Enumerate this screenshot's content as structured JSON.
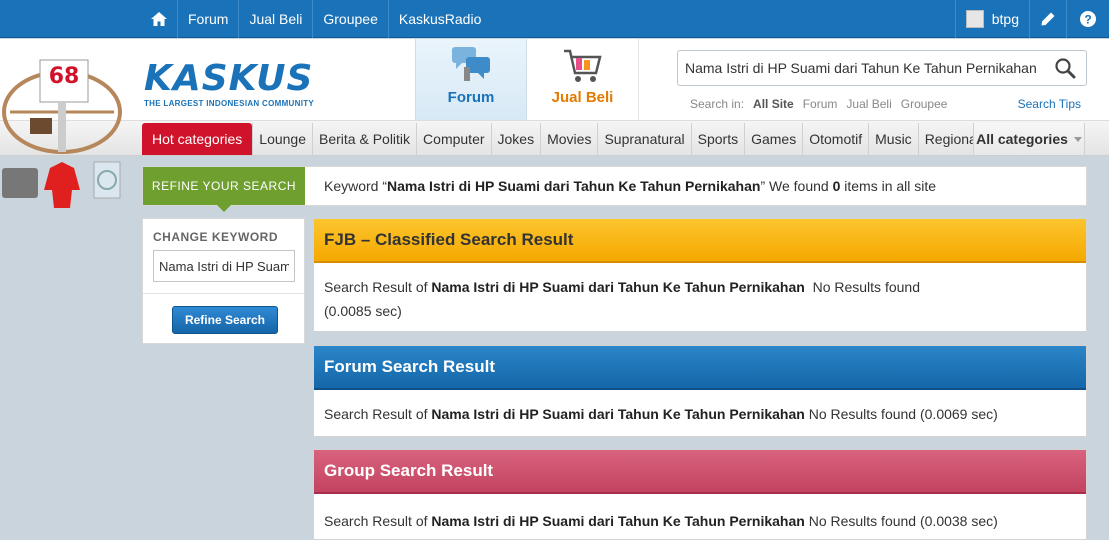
{
  "topnav": {
    "items": [
      "Forum",
      "Jual Beli",
      "Groupee",
      "KaskusRadio"
    ],
    "username": "btpg"
  },
  "header": {
    "logo_text_a": "KASKUS",
    "logo_tagline": "THE LARGEST INDONESIAN COMMUNITY",
    "tab_forum": "Forum",
    "tab_jualbeli": "Jual Beli",
    "search_value": "Nama Istri di HP Suami dari Tahun Ke Tahun Pernikahan",
    "search_in_label": "Search in:",
    "search_in_options": [
      "All Site",
      "Forum",
      "Jual Beli",
      "Groupee"
    ],
    "search_tips": "Search Tips"
  },
  "mascot_badge": "68",
  "categories": {
    "items": [
      "Hot categories",
      "Lounge",
      "Berita & Politik",
      "Computer",
      "Jokes",
      "Movies",
      "Supranatural",
      "Sports",
      "Games",
      "Otomotif",
      "Music",
      "Regional"
    ],
    "all": "All categories"
  },
  "refine": {
    "tag": "REFINE YOUR SEARCH",
    "kw_prefix": "Keyword “",
    "kw_value": "Nama Istri di HP Suami dari Tahun Ke Tahun Pernikahan",
    "kw_mid": "” We found ",
    "kw_count": "0",
    "kw_suffix": " items in all site"
  },
  "change_keyword": {
    "title": "CHANGE KEYWORD",
    "value": "Nama Istri di HP Suami dari Tahun Ke Tahun Pernikahan",
    "button": "Refine Search"
  },
  "results": {
    "fjb": {
      "title": "FJB – Classified Search Result",
      "prefix": "Search Result of ",
      "term": "Nama Istri di HP Suami dari Tahun Ke Tahun Pernikahan",
      "suffix": "  No Results found (0.0085 sec)"
    },
    "forum": {
      "title": "Forum Search Result",
      "prefix": "Search Result of ",
      "term": "Nama Istri di HP Suami dari Tahun Ke Tahun Pernikahan",
      "suffix": " No Results found (0.0069 sec)"
    },
    "group": {
      "title": "Group Search Result",
      "prefix": "Search Result of ",
      "term": "Nama Istri di HP Suami dari Tahun Ke Tahun Pernikahan",
      "suffix": " No Results found (0.0038 sec)"
    }
  },
  "icons": {
    "home": "home-icon",
    "edit": "pencil-icon",
    "help": "help-icon",
    "search": "magnifier-icon"
  },
  "colors": {
    "brand_blue": "#1a72b8",
    "hot_red": "#d0132a",
    "refine_green": "#6e9f2f",
    "fjb_yellow": "#f5a900",
    "group_pink": "#c2435f"
  }
}
